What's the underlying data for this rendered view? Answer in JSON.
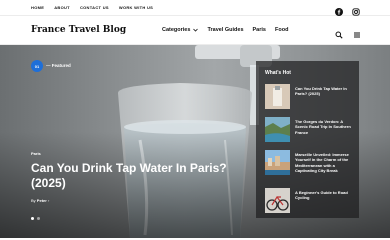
{
  "topbar": {
    "links": [
      "HOME",
      "ABOUT",
      "CONTACT US",
      "WORK WITH US"
    ]
  },
  "nav": {
    "logo": "France Travel Blog",
    "links": [
      {
        "label": "Categories"
      },
      {
        "label": "Travel Guides"
      },
      {
        "label": "Paris"
      },
      {
        "label": "Food"
      }
    ]
  },
  "hero": {
    "badge": "01",
    "featured_label": "— Featured",
    "category": "Paris",
    "title": "Can You Drink Tap Water In Paris? (2025)",
    "by": "By",
    "author": "Peter",
    "slide_count": 2
  },
  "whats_hot": {
    "title": "What's Hot",
    "items": [
      {
        "title": "Can You Drink Tap Water In Paris? (2025)"
      },
      {
        "title": "The Gorges du Verdon: A Scenic Road Trip In Southern France"
      },
      {
        "title": "Marseille Unveiled: Immerse Yourself in the Charm of the Mediterranean with a Captivating City Break"
      },
      {
        "title": "A Beginner's Guide to Road Cycling"
      }
    ]
  },
  "colors": {
    "accent": "#1e6fd9",
    "panel": "#1e1e20"
  }
}
